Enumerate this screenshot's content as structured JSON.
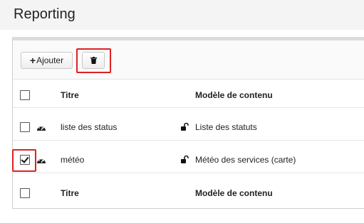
{
  "page": {
    "title": "Reporting"
  },
  "toolbar": {
    "add_label": "Ajouter",
    "add_icon": "plus-icon",
    "delete_icon": "trash-icon",
    "highlight_color": "#e02020"
  },
  "table": {
    "headers": {
      "title": "Titre",
      "model": "Modèle de contenu"
    },
    "rows": [
      {
        "title": "liste des status",
        "model": "Liste des statuts",
        "checked": false,
        "row_icon": "gauge-icon",
        "model_icon": "unlock-icon"
      },
      {
        "title": "météo",
        "model": "Météo des services (carte)",
        "checked": true,
        "row_icon": "gauge-icon",
        "model_icon": "unlock-icon"
      }
    ],
    "footer": {
      "title": "Titre",
      "model": "Modèle de contenu"
    }
  }
}
